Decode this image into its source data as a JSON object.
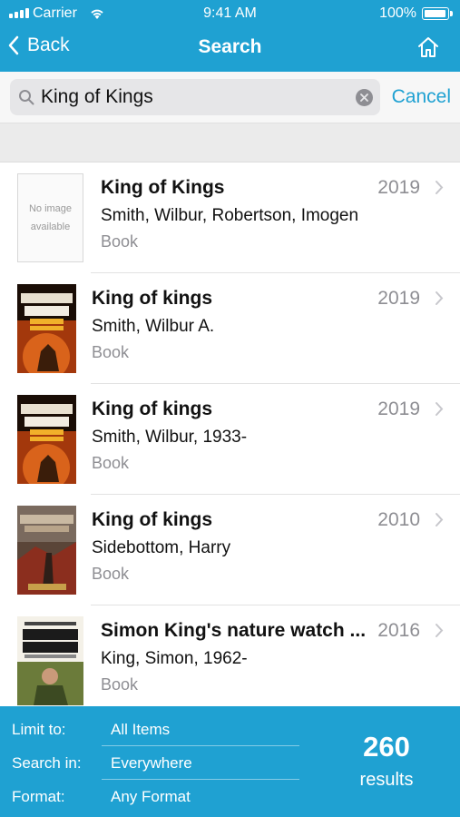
{
  "status_bar": {
    "carrier": "Carrier",
    "time": "9:41 AM",
    "battery": "100%",
    "battery_level": 1.0
  },
  "nav": {
    "back_label": "Back",
    "title": "Search",
    "home_icon": "home-icon"
  },
  "search": {
    "query": "King of Kings",
    "cancel_label": "Cancel"
  },
  "results": [
    {
      "title": "King of Kings",
      "author": "Smith, Wilbur, Robertson, Imogen",
      "type": "Book",
      "year": "2019",
      "cover": "no-image",
      "cover_text": "No image available"
    },
    {
      "title": "King of kings",
      "author": "Smith, Wilbur A.",
      "type": "Book",
      "year": "2019",
      "cover": "king-of-kings-cover"
    },
    {
      "title": "King of kings",
      "author": "Smith, Wilbur, 1933-",
      "type": "Book",
      "year": "2019",
      "cover": "king-of-kings-cover"
    },
    {
      "title": "King of kings",
      "author": "Sidebottom, Harry",
      "type": "Book",
      "year": "2010",
      "cover": "warrior-of-rome-cover"
    },
    {
      "title": "Simon King's nature watch ...",
      "author": "King, Simon, 1962-",
      "type": "Book",
      "year": "2016",
      "cover": "nature-watch-cover"
    }
  ],
  "footer": {
    "limit_label": "Limit to:",
    "limit_value": "All Items",
    "search_in_label": "Search in:",
    "search_in_value": "Everywhere",
    "format_label": "Format:",
    "format_value": "Any Format",
    "count": "260",
    "count_label": "results"
  },
  "colors": {
    "accent": "#1fa1d2",
    "secondary_text": "#8e8e93"
  }
}
